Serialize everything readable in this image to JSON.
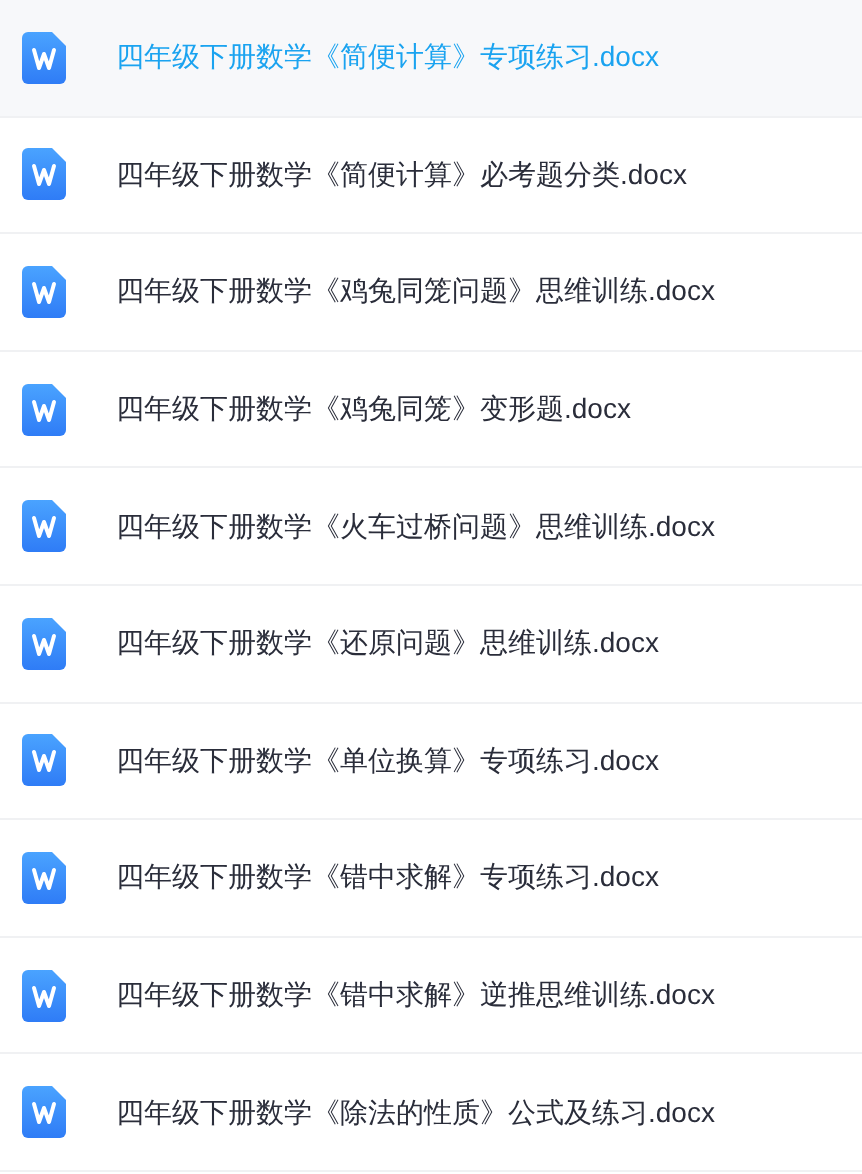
{
  "files": [
    {
      "name": "四年级下册数学《简便计算》专项练习.docx",
      "selected": true
    },
    {
      "name": "四年级下册数学《简便计算》必考题分类.docx",
      "selected": false
    },
    {
      "name": "四年级下册数学《鸡兔同笼问题》思维训练.docx",
      "selected": false
    },
    {
      "name": "四年级下册数学《鸡兔同笼》变形题.docx",
      "selected": false
    },
    {
      "name": "四年级下册数学《火车过桥问题》思维训练.docx",
      "selected": false
    },
    {
      "name": "四年级下册数学《还原问题》思维训练.docx",
      "selected": false
    },
    {
      "name": "四年级下册数学《单位换算》专项练习.docx",
      "selected": false
    },
    {
      "name": "四年级下册数学《错中求解》专项练习.docx",
      "selected": false
    },
    {
      "name": "四年级下册数学《错中求解》逆推思维训练.docx",
      "selected": false
    },
    {
      "name": "四年级下册数学《除法的性质》公式及练习.docx",
      "selected": false
    }
  ]
}
